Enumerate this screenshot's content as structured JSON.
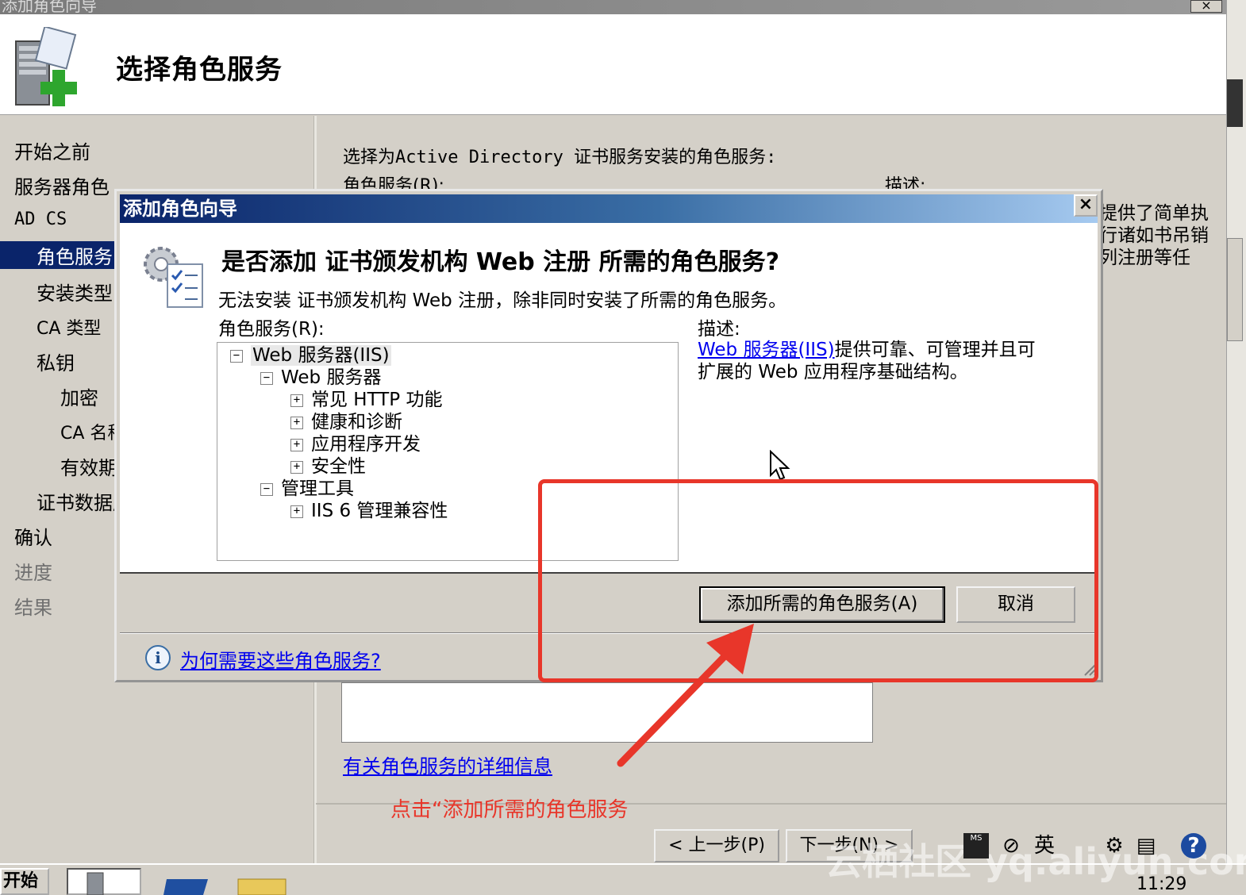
{
  "outer_window": {
    "title": "添加角色向导",
    "close_label": "×",
    "header_title": "选择角色服务",
    "nav": [
      {
        "label": "开始之前",
        "state": "normal"
      },
      {
        "label": "服务器角色",
        "state": "normal"
      },
      {
        "label": "AD CS",
        "state": "normal"
      },
      {
        "label": "角色服务",
        "state": "selected"
      },
      {
        "label": "安装类型",
        "state": "normal"
      },
      {
        "label": "CA 类型",
        "state": "normal"
      },
      {
        "label": "私钥",
        "state": "normal"
      },
      {
        "label": "加密",
        "state": "normal"
      },
      {
        "label": "CA 名称",
        "state": "normal"
      },
      {
        "label": "有效期",
        "state": "normal"
      },
      {
        "label": "证书数据库",
        "state": "normal"
      },
      {
        "label": "确认",
        "state": "normal"
      },
      {
        "label": "进度",
        "state": "disabled"
      },
      {
        "label": "结果",
        "state": "disabled"
      }
    ],
    "content_intro": "选择为Active Directory 证书服务安装的角色服务:",
    "roles_label": "角色服务(R):",
    "desc_label": "描述:",
    "desc_text": "提供了简单执行诸如书吊销列注册等任",
    "details_link": "有关角色服务的详细信息",
    "prev_button": "< 上一步(P)",
    "next_button": "下一步(N) >"
  },
  "dialog": {
    "title": "添加角色向导",
    "close_label": "×",
    "question": "是否添加 证书颁发机构 Web 注册 所需的角色服务?",
    "message": "无法安装 证书颁发机构 Web 注册，除非同时安装了所需的角色服务。",
    "roles_label": "角色服务(R):",
    "desc_label": "描述:",
    "desc_link": "Web 服务器(IIS)",
    "desc_text": "提供可靠、可管理并且可扩展的 Web 应用程序基础结构。",
    "tree": [
      {
        "label": "Web 服务器(IIS)",
        "toggle": "−",
        "level": 0
      },
      {
        "label": "Web 服务器",
        "toggle": "−",
        "level": 1
      },
      {
        "label": "常见 HTTP 功能",
        "toggle": "+",
        "level": 2
      },
      {
        "label": "健康和诊断",
        "toggle": "+",
        "level": 2
      },
      {
        "label": "应用程序开发",
        "toggle": "+",
        "level": 2
      },
      {
        "label": "安全性",
        "toggle": "+",
        "level": 2
      },
      {
        "label": "管理工具",
        "toggle": "−",
        "level": 1
      },
      {
        "label": "IIS 6 管理兼容性",
        "toggle": "+",
        "level": 2
      }
    ],
    "add_button": "添加所需的角色服务(A)",
    "cancel_button": "取消",
    "help_icon": "i",
    "help_link": "为何需要这些角色服务?"
  },
  "annotation": {
    "text": "点击“添加所需的角色服务",
    "color": "#e8362a"
  },
  "taskbar": {
    "start_label": "开始",
    "clock": "11:29",
    "tray_lang": "英",
    "watermark": "云栖社区 yq.aliyun.com"
  }
}
